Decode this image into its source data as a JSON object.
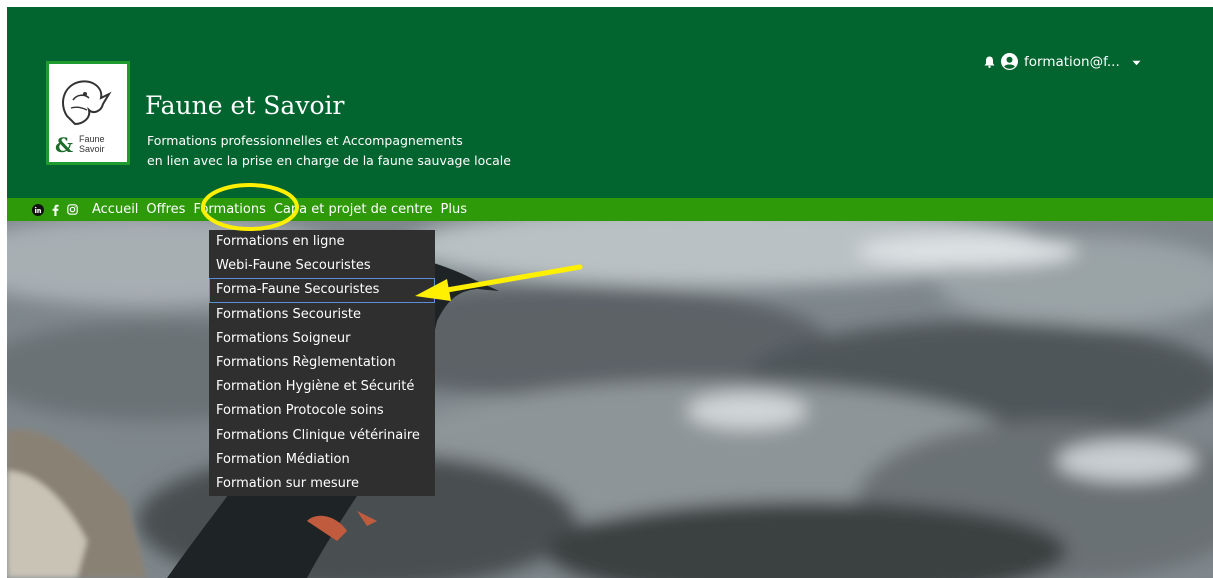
{
  "header": {
    "logo": {
      "amp": "&",
      "word1": "Faune",
      "word2": "Savoir"
    },
    "title": "Faune et Savoir",
    "tagline1": "Formations professionnelles et Accompagnements",
    "tagline2": "en lien avec la prise en charge de la faune sauvage locale",
    "user": {
      "email": "formation@f...",
      "bell_icon": "bell-icon",
      "user_icon": "user-circle-icon"
    }
  },
  "nav": {
    "social": [
      "linkedin-icon",
      "facebook-icon",
      "instagram-icon"
    ],
    "items": [
      "Accueil",
      "Offres",
      "Formations",
      "Capa et projet de centre",
      "Plus"
    ]
  },
  "dropdown": {
    "items": [
      "Formations en ligne",
      "Webi-Faune Secouristes",
      "Forma-Faune Secouristes",
      "Formations Secouriste",
      "Formations Soigneur",
      "Formations Règlementation",
      "Formation Hygiène et Sécurité",
      "Formation Protocole soins",
      "Formations Clinique vétérinaire",
      "Formation Médiation",
      "Formation sur mesure"
    ]
  },
  "colors": {
    "header_bg": "#02652f",
    "nav_bg": "#2e9a0a",
    "dropdown_bg": "#2f2f2f",
    "highlight_circle": "#ffef00",
    "arrow": "#ffef00"
  }
}
